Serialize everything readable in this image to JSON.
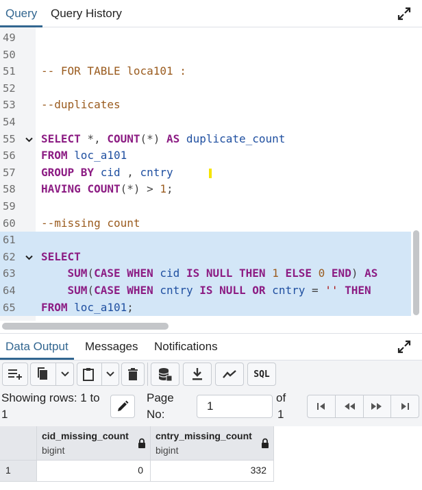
{
  "top_tabs": [
    {
      "label": "Query",
      "active": true
    },
    {
      "label": "Query History",
      "active": false
    }
  ],
  "editor": {
    "lines": [
      {
        "n": "49",
        "tokens": []
      },
      {
        "n": "50",
        "tokens": []
      },
      {
        "n": "51",
        "tokens": [
          {
            "t": "-- FOR TABLE loca101 :",
            "c": "cm"
          }
        ]
      },
      {
        "n": "52",
        "tokens": []
      },
      {
        "n": "53",
        "tokens": [
          {
            "t": "--duplicates",
            "c": "cm"
          }
        ]
      },
      {
        "n": "54",
        "tokens": []
      },
      {
        "n": "55",
        "fold": true,
        "tokens": [
          {
            "t": "SELECT",
            "c": "kw"
          },
          {
            "t": " *, ",
            "c": "op"
          },
          {
            "t": "COUNT",
            "c": "kw"
          },
          {
            "t": "(*) ",
            "c": "op"
          },
          {
            "t": "AS",
            "c": "kw"
          },
          {
            "t": " duplicate_count",
            "c": "id"
          }
        ]
      },
      {
        "n": "56",
        "tokens": [
          {
            "t": "FROM",
            "c": "kw"
          },
          {
            "t": " loc_a101",
            "c": "id"
          }
        ]
      },
      {
        "n": "57",
        "tokens": [
          {
            "t": "GROUP BY",
            "c": "kw"
          },
          {
            "t": " cid",
            "c": "id"
          },
          {
            "t": " , ",
            "c": "op"
          },
          {
            "t": "cntry",
            "c": "id"
          }
        ]
      },
      {
        "n": "58",
        "tokens": [
          {
            "t": "HAVING",
            "c": "kw"
          },
          {
            "t": " ",
            "c": "op"
          },
          {
            "t": "COUNT",
            "c": "kw"
          },
          {
            "t": "(*) > ",
            "c": "op"
          },
          {
            "t": "1",
            "c": "nm"
          },
          {
            "t": ";",
            "c": "op"
          }
        ]
      },
      {
        "n": "59",
        "tokens": []
      },
      {
        "n": "60",
        "tokens": [
          {
            "t": "--missing count",
            "c": "cm"
          }
        ]
      },
      {
        "n": "61",
        "sel": true,
        "tokens": []
      },
      {
        "n": "62",
        "sel": true,
        "fold": true,
        "tokens": [
          {
            "t": "SELECT",
            "c": "kw"
          }
        ]
      },
      {
        "n": "63",
        "sel": true,
        "tokens": [
          {
            "t": "    ",
            "c": "op"
          },
          {
            "t": "SUM",
            "c": "kw"
          },
          {
            "t": "(",
            "c": "op"
          },
          {
            "t": "CASE WHEN",
            "c": "kw"
          },
          {
            "t": " cid ",
            "c": "id"
          },
          {
            "t": "IS NULL THEN",
            "c": "kw"
          },
          {
            "t": " ",
            "c": "op"
          },
          {
            "t": "1",
            "c": "nm"
          },
          {
            "t": " ",
            "c": "op"
          },
          {
            "t": "ELSE",
            "c": "kw"
          },
          {
            "t": " ",
            "c": "op"
          },
          {
            "t": "0",
            "c": "nm"
          },
          {
            "t": " ",
            "c": "op"
          },
          {
            "t": "END",
            "c": "kw"
          },
          {
            "t": ") ",
            "c": "op"
          },
          {
            "t": "AS",
            "c": "kw"
          }
        ]
      },
      {
        "n": "64",
        "sel": true,
        "tokens": [
          {
            "t": "    ",
            "c": "op"
          },
          {
            "t": "SUM",
            "c": "kw"
          },
          {
            "t": "(",
            "c": "op"
          },
          {
            "t": "CASE WHEN",
            "c": "kw"
          },
          {
            "t": " cntry ",
            "c": "id"
          },
          {
            "t": "IS NULL OR",
            "c": "kw"
          },
          {
            "t": " cntry",
            "c": "id"
          },
          {
            "t": " = ",
            "c": "op"
          },
          {
            "t": "''",
            "c": "st"
          },
          {
            "t": " ",
            "c": "op"
          },
          {
            "t": "THEN",
            "c": "kw"
          }
        ]
      },
      {
        "n": "65",
        "sel": true,
        "tokens": [
          {
            "t": "FROM",
            "c": "kw"
          },
          {
            "t": " loc_a101",
            "c": "id"
          },
          {
            "t": ";",
            "c": "op"
          }
        ]
      }
    ]
  },
  "output_tabs": [
    {
      "label": "Data Output",
      "active": true
    },
    {
      "label": "Messages",
      "active": false
    },
    {
      "label": "Notifications",
      "active": false
    }
  ],
  "toolbar": {
    "sql_label": "SQL"
  },
  "pager": {
    "showing_label": "Showing rows: 1 to",
    "showing_to": "1",
    "page_label_1": "Page",
    "page_label_2": "No:",
    "page_value": "1",
    "of_label": "of",
    "of_value": "1"
  },
  "grid": {
    "columns": [
      {
        "name": "cid_missing_count",
        "type": "bigint"
      },
      {
        "name": "cntry_missing_count",
        "type": "bigint"
      }
    ],
    "rows": [
      {
        "index": "1",
        "values": [
          "0",
          "332"
        ]
      }
    ]
  }
}
